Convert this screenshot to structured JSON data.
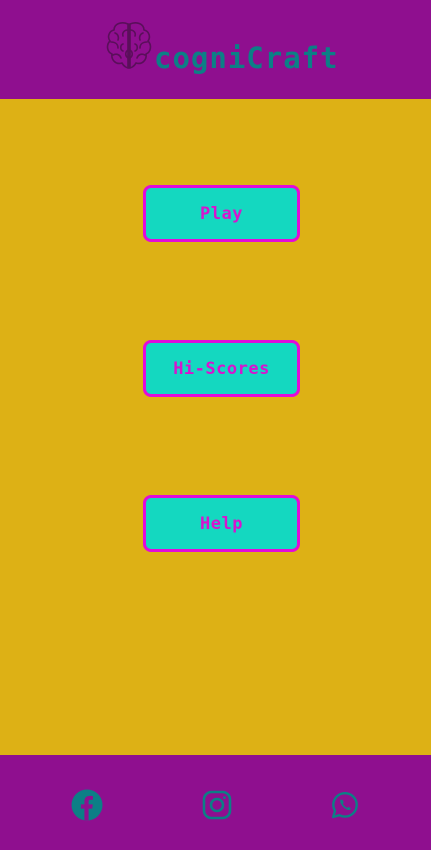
{
  "header": {
    "app_name": "cogniCraft",
    "logo_icon": "brain-icon"
  },
  "menu": {
    "items": [
      {
        "label": "Play"
      },
      {
        "label": "Hi-Scores"
      },
      {
        "label": "Help"
      }
    ]
  },
  "footer": {
    "social": [
      {
        "icon": "facebook-icon"
      },
      {
        "icon": "instagram-icon"
      },
      {
        "icon": "whatsapp-icon"
      }
    ]
  },
  "colors": {
    "header_bg": "#8F0F8F",
    "page_bg": "#DDB115",
    "button_bg": "#14D8C0",
    "button_border": "#E20BDA",
    "button_text": "#D714CE",
    "brand_teal": "#0C7F86"
  }
}
